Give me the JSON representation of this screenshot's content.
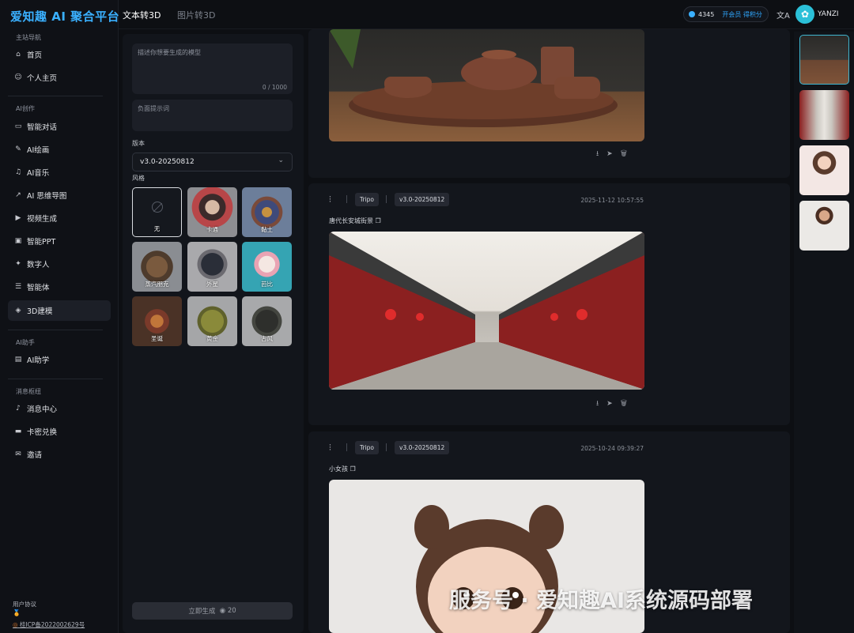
{
  "app": {
    "logo": "爱知趣 AI 聚合平台"
  },
  "header": {
    "tabs": [
      "文本转3D",
      "图片转3D"
    ],
    "credits": "4345",
    "vip_label": "开会员 得积分",
    "user": "YANZI"
  },
  "sidebar": {
    "sections": [
      "主站导航",
      "AI创作",
      "AI助手",
      "消息枢纽"
    ],
    "items": [
      "首页",
      "个人主页",
      "智能对话",
      "AI绘画",
      "AI音乐",
      "AI 思维导图",
      "视频生成",
      "智能PPT",
      "数字人",
      "智能体",
      "3D建模",
      "AI助学",
      "消息中心",
      "卡密兑换",
      "邀请"
    ],
    "active": "3D建模",
    "footer": {
      "agreement": "用户协议",
      "icp": "桂ICP备2022002629号"
    }
  },
  "form": {
    "prompt_placeholder": "描述你想要生成的模型",
    "counter": "0 / 1000",
    "negative_placeholder": "负面提示词",
    "version_label": "版本",
    "version_value": "v3.0-20250812",
    "style_label": "风格",
    "styles": [
      "无",
      "卡通",
      "黏土",
      "蒸汽朋克",
      "外星",
      "芭比",
      "圣诞",
      "黄金",
      "古风"
    ],
    "generate_label": "立即生成",
    "generate_cost": "20"
  },
  "results": [
    {
      "provider": "Tripo",
      "version": "v3.0-20250812",
      "date": "2025-11-12 10:57:55",
      "prompt": "唐代长安城街景"
    },
    {
      "provider": "Tripo",
      "version": "v3.0-20250812",
      "date": "2025-10-24 09:39:27",
      "prompt": "小女孩"
    }
  ],
  "watermark": "服务号 · 爱知趣AI系统源码部署",
  "colors": {
    "accent": "#3ab0ff",
    "bg": "#0d0f13",
    "card": "#13161c"
  }
}
